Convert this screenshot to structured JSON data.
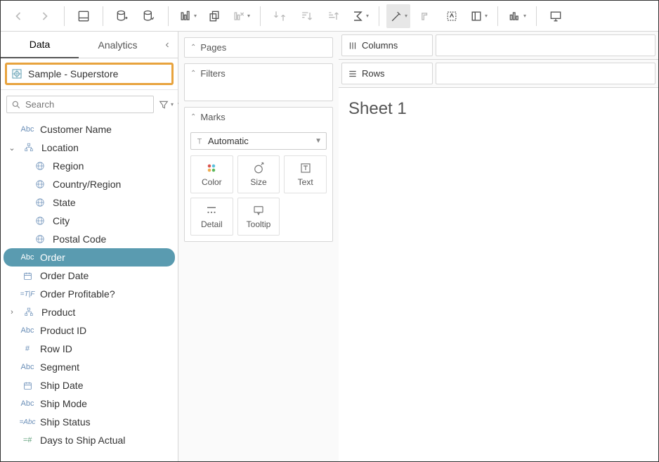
{
  "tabs": {
    "data": "Data",
    "analytics": "Analytics"
  },
  "data_source": "Sample - Superstore",
  "search_placeholder": "Search",
  "fields": {
    "customer_name": "Customer Name",
    "location": "Location",
    "region": "Region",
    "country_region": "Country/Region",
    "state": "State",
    "city": "City",
    "postal_code": "Postal Code",
    "order": "Order",
    "order_date": "Order Date",
    "order_profitable": "Order Profitable?",
    "product": "Product",
    "product_id": "Product ID",
    "row_id": "Row ID",
    "segment": "Segment",
    "ship_date": "Ship Date",
    "ship_mode": "Ship Mode",
    "ship_status": "Ship Status",
    "days_to_ship_actual": "Days to Ship Actual"
  },
  "shelves": {
    "pages": "Pages",
    "filters": "Filters",
    "marks": "Marks",
    "columns": "Columns",
    "rows": "Rows"
  },
  "mark_type": "Automatic",
  "mark_cells": {
    "color": "Color",
    "size": "Size",
    "text": "Text",
    "detail": "Detail",
    "tooltip": "Tooltip"
  },
  "sheet_title": "Sheet 1",
  "icons": {
    "abc": "Abc",
    "tf": "T|F",
    "tfcalc": "=T|F",
    "abccalc": "=Abc",
    "hash": "#",
    "hashcalc": "=#"
  }
}
